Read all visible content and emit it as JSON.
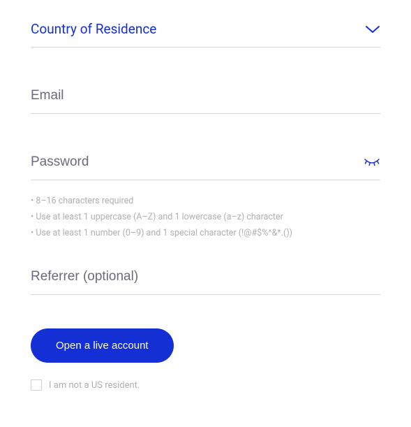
{
  "fields": {
    "country": {
      "label": "Country of Residence"
    },
    "email": {
      "placeholder": "Email"
    },
    "password": {
      "placeholder": "Password"
    },
    "referrer": {
      "placeholder": "Referrer (optional)"
    }
  },
  "password_hints": [
    "• 8–16 characters required",
    "• Use at least 1 uppercase (A–Z) and 1 lowercase (a–z) character",
    "• Use at least 1 number (0–9) and 1 special character (!@#$%^&*.())"
  ],
  "submit_label": "Open a live account",
  "us_resident_checkbox": {
    "checked": false,
    "label": "I am not a US resident."
  }
}
